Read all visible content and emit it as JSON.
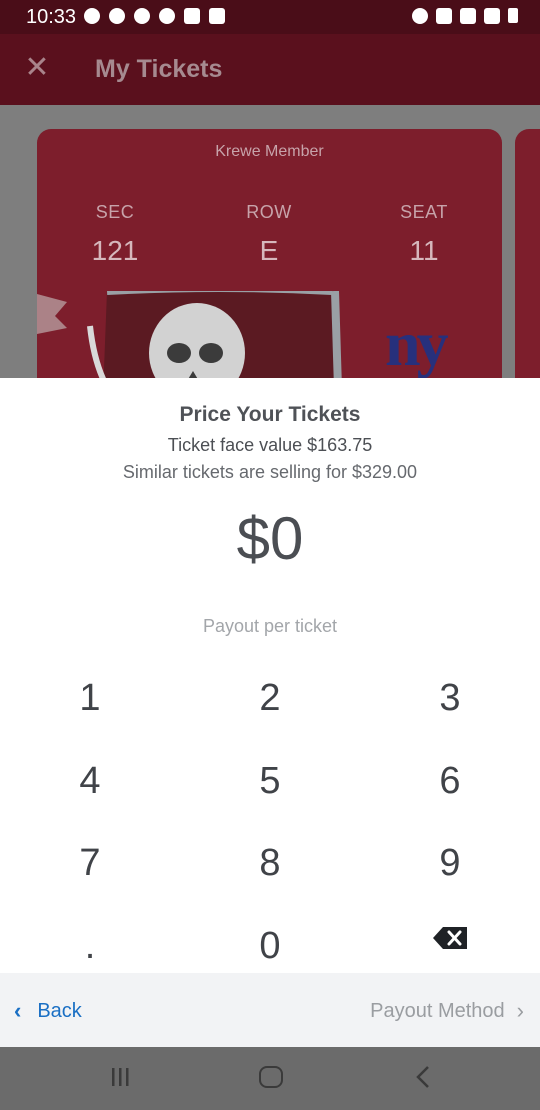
{
  "status_bar": {
    "time": "10:33",
    "left_icons": [
      "messenger-icon",
      "facebook-icon",
      "tag-icon",
      "alarm-icon",
      "bag-icon",
      "youtube-icon"
    ],
    "right_icons": [
      "alarm-icon",
      "lock-icon",
      "data-icon",
      "signal-icon",
      "battery-icon"
    ]
  },
  "app_bar": {
    "title": "My Tickets",
    "close_icon": "close-icon"
  },
  "ticket": {
    "tier": "Krewe Member",
    "sec_label": "SEC",
    "sec_value": "121",
    "row_label": "ROW",
    "row_value": "E",
    "seat_label": "SEAT",
    "seat_value": "11",
    "opponent_logo_text": "ny"
  },
  "pricing": {
    "title": "Price Your Tickets",
    "face_value": "Ticket face value $163.75",
    "similar": "Similar tickets are selling for $329.00",
    "price": "$0",
    "payout_label": "Payout per ticket"
  },
  "keypad": {
    "k1": "1",
    "k2": "2",
    "k3": "3",
    "k4": "4",
    "k5": "5",
    "k6": "6",
    "k7": "7",
    "k8": "8",
    "k9": "9",
    "dot": ".",
    "k0": "0",
    "backspace_icon": "backspace-icon"
  },
  "footer": {
    "back_label": "Back",
    "next_label": "Payout Method"
  },
  "colors": {
    "team_red": "#7d1e2c",
    "link_blue": "#1a6fc4",
    "disabled_gray": "#9a9da1"
  }
}
